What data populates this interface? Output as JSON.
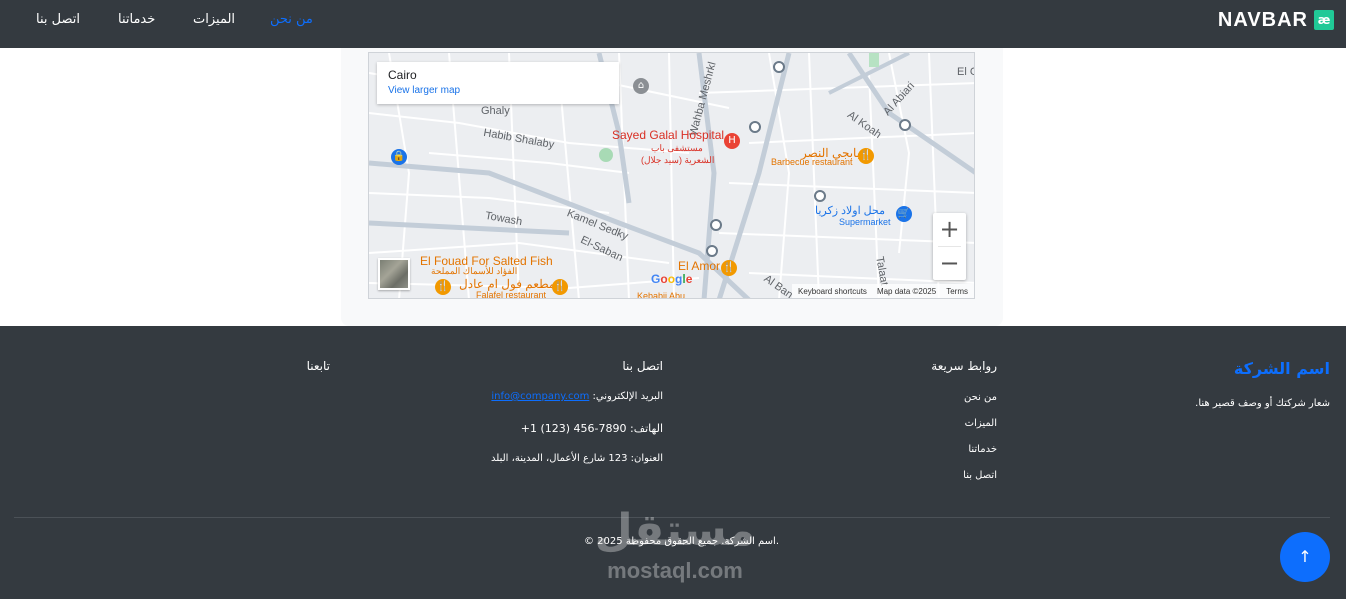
{
  "navbar": {
    "brand_logo": "æ",
    "brand": "NAVBAR",
    "links": [
      "من نحن",
      "الميزات",
      "خدماتنا",
      "اتصل بنا"
    ],
    "active_index": 0
  },
  "map": {
    "info_title": "Cairo",
    "info_link": "View larger map",
    "labels": {
      "el_gei": "El Gei",
      "ghaly": "Ghaly",
      "habib_shalaby": "Habib Shalaby",
      "towash": "Towash",
      "kamel_sedky": "Kamel Sedky",
      "el_saban": "El-Saban",
      "al_abiari": "Al Abiari",
      "al_koah": "Al Koah",
      "wahba": "Wahba Meshrkl",
      "talaat": "Talaat",
      "al_ban": "Al Ban",
      "sayed_galal": "Sayed Galal Hospital",
      "sayed_galal_ar1": "مستشفى باب",
      "sayed_galal_ar2": "الشعرية (سيد جلال)",
      "kababgy_ar": "كبابجي النصر",
      "barbecue": "Barbecue restaurant",
      "awlad_zakaria_ar": "محل اولاد زكريا",
      "supermarket": "Supermarket",
      "el_fouad": "El Fouad For Salted Fish",
      "el_fouad_ar": "الفؤاد للأسماك المملحة",
      "foul_ar": "مطعم فول ام عادل",
      "falafel": "Falafel restaurant",
      "el_amor": "El Amor",
      "kebabji": "Kebabji Abu",
      "zoom_in": "+",
      "zoom_out": "−",
      "keyboard": "Keyboard shortcuts",
      "map_data": "Map data ©2025",
      "terms": "Terms",
      "google": "Google"
    }
  },
  "footer": {
    "company_name": "اسم الشركة",
    "tagline": "شعار شركتك أو وصف قصير هنا.",
    "quick_links_title": "روابط سريعة",
    "quick_links": [
      "من نحن",
      "الميزات",
      "خدماتنا",
      "اتصل بنا"
    ],
    "contact_title": "اتصل بنا",
    "email_label": "البريد الإلكتروني:",
    "email": "info@company.com",
    "phone_label": "الهاتف:",
    "phone": "+1 (123) 456-7890",
    "address_label": "العنوان:",
    "address": "123 شارع الأعمال، المدينة، البلد",
    "follow_title": "تابعنا",
    "copyright": "© 2025 اسم الشركة. جميع الحقوق محفوظة.",
    "watermark_ar": "مستقل",
    "watermark_en": "mostaql.com",
    "scroll_top": "↑"
  }
}
